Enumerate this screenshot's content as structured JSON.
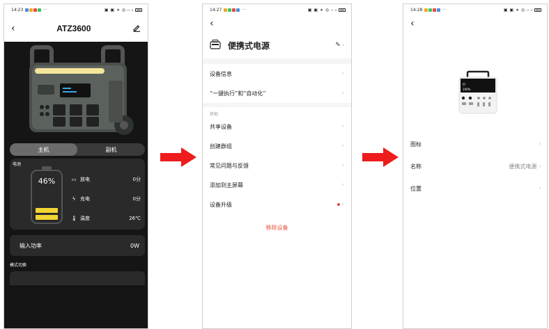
{
  "colors": {
    "accent_red": "#ee1c1c",
    "battery_yellow": "#f2d533",
    "remove_red": "#e6553a"
  },
  "phone1": {
    "status": {
      "time": "14:23",
      "right": "ⒷⒸ∗ ◍⁴ᴳ⑴⑵"
    },
    "header": {
      "title": "ATZ3600",
      "back_icon": "chevron-left-icon",
      "edit_icon": "pencil-icon"
    },
    "tabs": [
      {
        "label": "主机"
      },
      {
        "label": "副机"
      }
    ],
    "battery_card": {
      "label": "电池",
      "percent_text": "46%",
      "level": 0.46,
      "stats": [
        {
          "icon": "discharge-icon",
          "label": "放电",
          "value": "0分"
        },
        {
          "icon": "charge-icon",
          "label": "充电",
          "value": "0分"
        },
        {
          "icon": "thermometer-icon",
          "label": "温度",
          "value": "26℃"
        }
      ]
    },
    "input_power": {
      "label": "输入功率",
      "value": "0W"
    },
    "mode_label": "模式切换"
  },
  "phone2": {
    "status": {
      "time": "14:27",
      "right": "ⒷⒸ∗ ◍⁴ᴳ⑴⑵"
    },
    "device_name": "便携式电源",
    "items_top": [
      {
        "label": "设备信息"
      },
      {
        "label": "“一键执行”和“自动化”"
      }
    ],
    "section_label": "其他",
    "items_other": [
      {
        "label": "共享设备"
      },
      {
        "label": "创建群组"
      },
      {
        "label": "常见问题与反馈"
      },
      {
        "label": "添加到主屏幕"
      },
      {
        "label": "设备升级"
      }
    ],
    "remove_label": "移除设备"
  },
  "phone3": {
    "status": {
      "time": "14:28",
      "right": "ⒷⒸ∗ ◍⁴ᴳ⑴⑵"
    },
    "device_screen_text": "100%",
    "items": [
      {
        "label": "图标",
        "value": ""
      },
      {
        "label": "名称",
        "value": "便携式电源"
      },
      {
        "label": "位置",
        "value": ""
      }
    ]
  }
}
